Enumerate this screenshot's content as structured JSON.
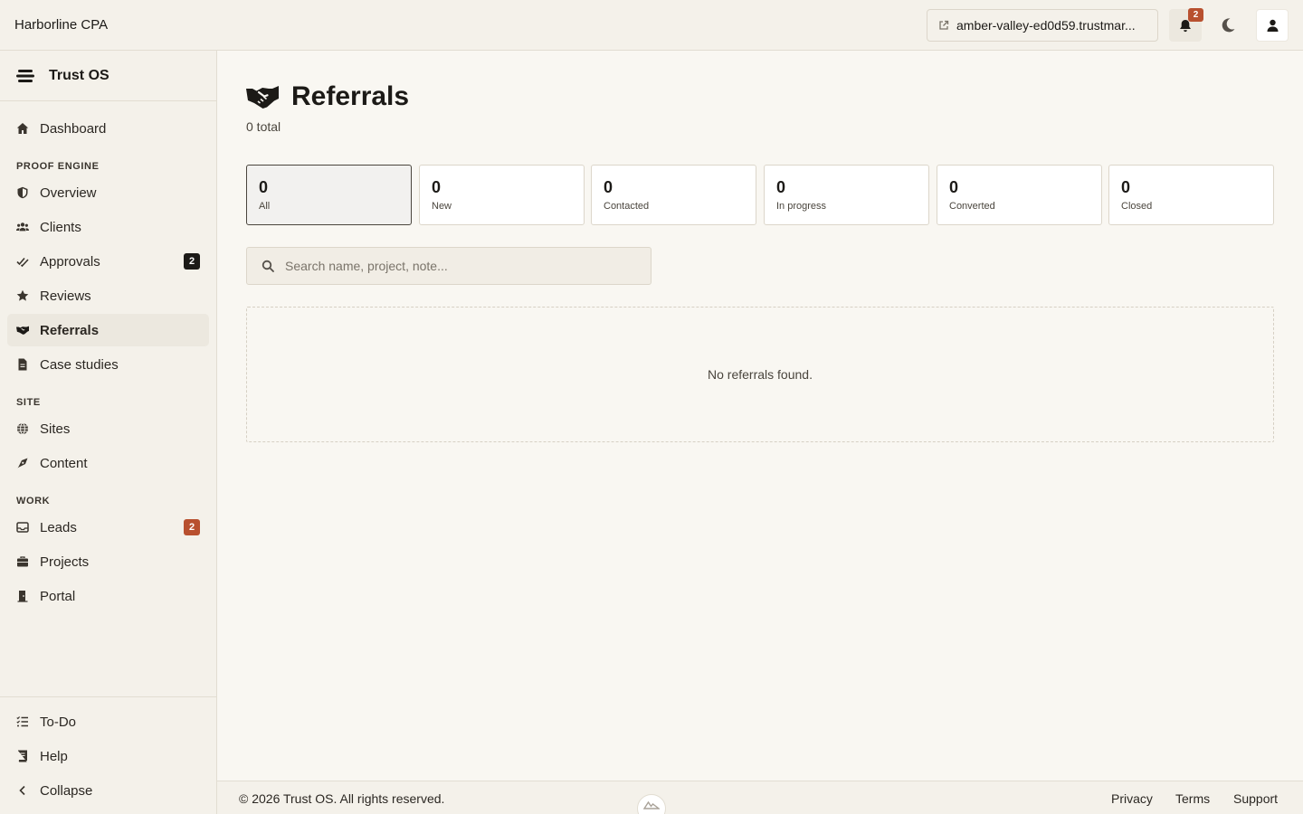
{
  "topbar": {
    "brand": "Harborline CPA",
    "site_domain": "amber-valley-ed0d59.trustmar...",
    "notifications_count": "2"
  },
  "sidebar": {
    "app_name": "Trust OS",
    "dashboard": "Dashboard",
    "sections": {
      "proof_engine": "PROOF ENGINE",
      "site": "SITE",
      "work": "WORK"
    },
    "items": {
      "overview": "Overview",
      "clients": "Clients",
      "approvals": "Approvals",
      "approvals_badge": "2",
      "reviews": "Reviews",
      "referrals": "Referrals",
      "case_studies": "Case studies",
      "sites": "Sites",
      "content": "Content",
      "leads": "Leads",
      "leads_badge": "2",
      "projects": "Projects",
      "portal": "Portal"
    },
    "footer": {
      "todo": "To-Do",
      "help": "Help",
      "collapse": "Collapse"
    }
  },
  "main": {
    "title": "Referrals",
    "subtitle": "0 total",
    "stats": [
      {
        "count": "0",
        "label": "All",
        "active": true
      },
      {
        "count": "0",
        "label": "New"
      },
      {
        "count": "0",
        "label": "Contacted"
      },
      {
        "count": "0",
        "label": "In progress"
      },
      {
        "count": "0",
        "label": "Converted"
      },
      {
        "count": "0",
        "label": "Closed"
      }
    ],
    "search_placeholder": "Search name, project, note...",
    "empty_message": "No referrals found."
  },
  "footer": {
    "copyright": "© 2026 Trust OS. All rights reserved.",
    "privacy": "Privacy",
    "terms": "Terms",
    "support": "Support"
  },
  "colors": {
    "background": "#f9f7f2",
    "sidebar": "#f4f1ea",
    "accent_badge": "#b8502f",
    "dark_badge": "#1c1a17"
  }
}
